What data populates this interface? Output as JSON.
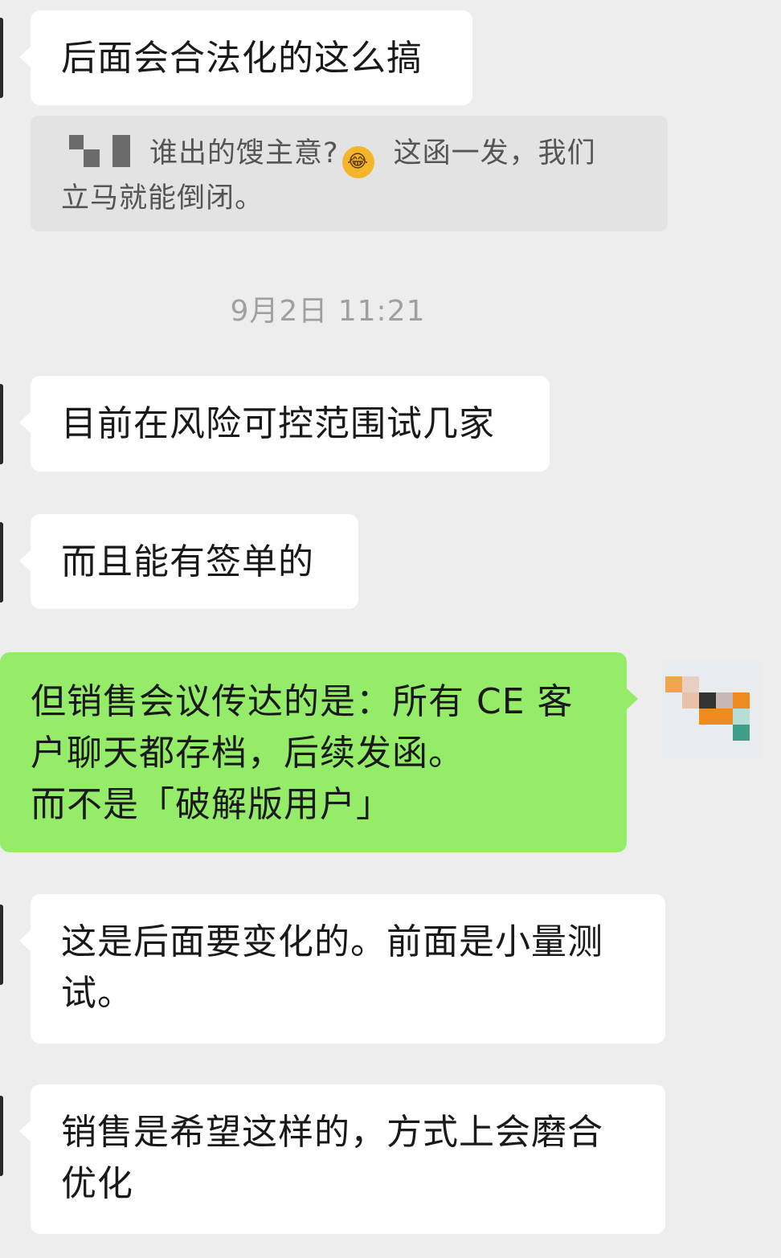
{
  "messages": [
    {
      "side": "left",
      "text": "后面会合法化的这么搞"
    },
    {
      "side": "left",
      "text": "目前在风险可控范围试几家"
    },
    {
      "side": "left",
      "text": "而且能有签单的"
    },
    {
      "side": "right",
      "text": "但销售会议传达的是：所有 CE 客\n户聊天都存档，后续发函。\n而不是「破解版用户」"
    },
    {
      "side": "left",
      "text": "这是后面要变化的。前面是小量测\n试。"
    },
    {
      "side": "left",
      "text": "销售是希望这样的，方式上会磨合\n优化"
    }
  ],
  "quote": {
    "line1": "谁出的馊主意?",
    "emoji": "crying-laughing-emoji",
    "line1_rest": "这函一发，我们",
    "line2": "立马就能倒闭。"
  },
  "timestamp": "9月2日 11:21",
  "colors": {
    "background": "#ededed",
    "incoming_bubble": "#ffffff",
    "outgoing_bubble": "#95ec69",
    "quote_background": "#e3e3e3",
    "timestamp_text": "#a0a0a0"
  }
}
